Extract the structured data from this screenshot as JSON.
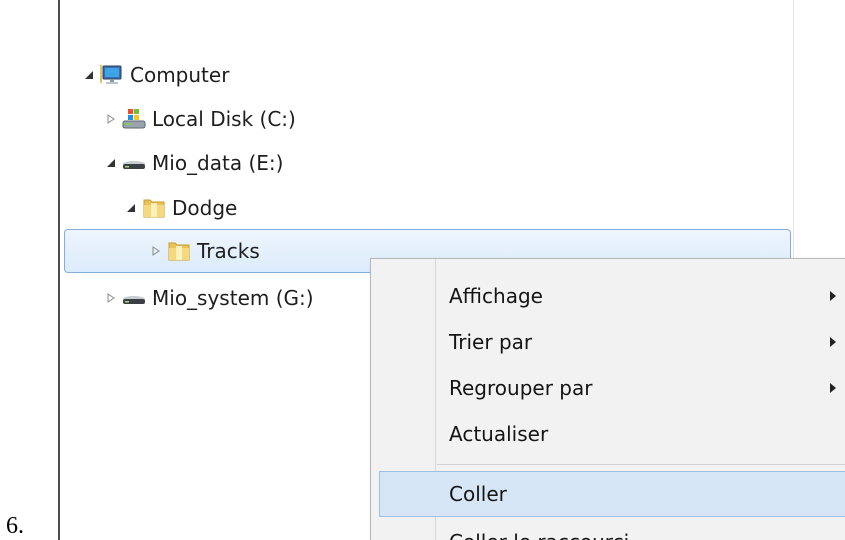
{
  "list_number": "6.",
  "tree": {
    "items": [
      {
        "label": "Computer",
        "icon": "computer-icon",
        "expanded": true
      },
      {
        "label": "Local Disk (C:)",
        "icon": "system-drive-icon",
        "expanded": false
      },
      {
        "label": "Mio_data (E:)",
        "icon": "drive-icon",
        "expanded": true
      },
      {
        "label": "Dodge",
        "icon": "folder-icon",
        "expanded": true
      },
      {
        "label": "Tracks",
        "icon": "folder-icon",
        "expanded": false,
        "selected": true
      },
      {
        "label": "Mio_system (G:)",
        "icon": "drive-icon",
        "expanded": false
      }
    ]
  },
  "context_menu": {
    "items": [
      {
        "label": "Affichage",
        "submenu": true
      },
      {
        "label": "Trier par",
        "submenu": true
      },
      {
        "label": "Regrouper par",
        "submenu": true
      },
      {
        "label": "Actualiser",
        "submenu": false
      },
      {
        "label": "Coller",
        "submenu": false,
        "highlighted": true
      },
      {
        "label": "Coller le raccourci",
        "submenu": false
      }
    ]
  },
  "colors": {
    "selection_border": "#84acdd",
    "menu_background": "#f2f2f2",
    "menu_hover": "#d7e6f7"
  }
}
